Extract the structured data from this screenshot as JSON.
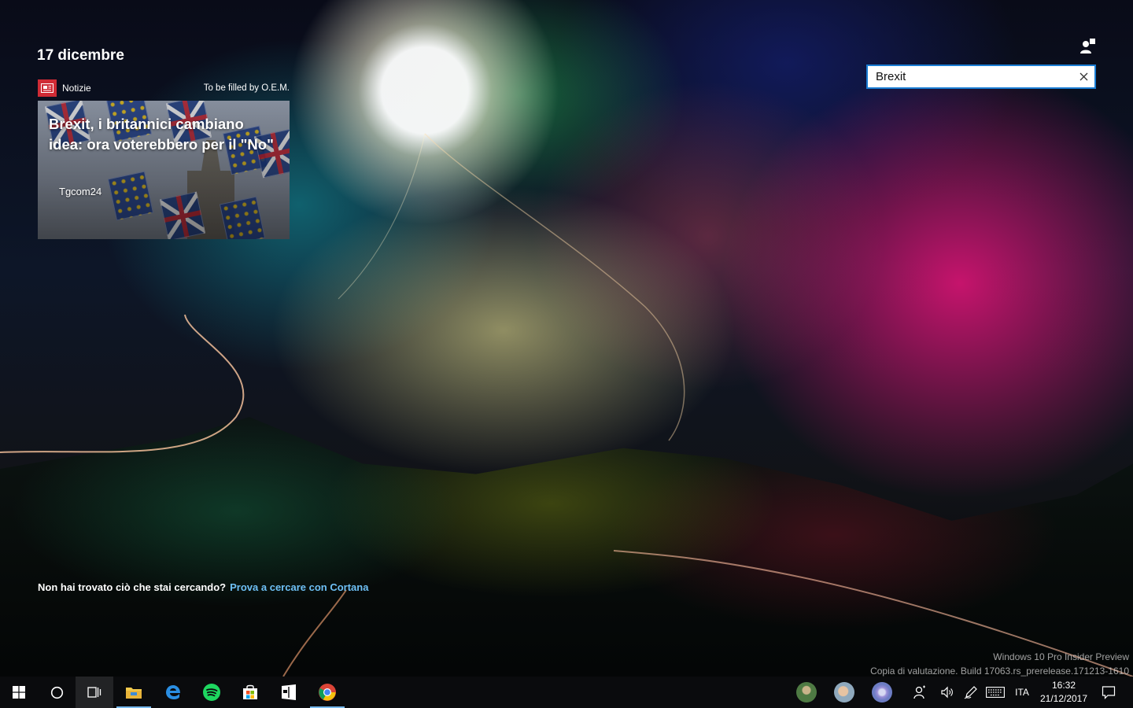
{
  "header": {
    "date": "17 dicembre"
  },
  "search": {
    "value": "Brexit",
    "placeholder": ""
  },
  "news": {
    "app_label": "Notizie",
    "attribution": "To be filled by O.E.M.",
    "headline": "Brexit, i britannici cambiano idea: ora voterebbero per il \"No\"",
    "source": "Tgcom24"
  },
  "cortana": {
    "question": "Non hai trovato ciò che stai cercando?",
    "link": "Prova a cercare con Cortana"
  },
  "watermark": {
    "line1": "Windows 10 Pro Insider Preview",
    "line2": "Copia di valutazione. Build 17063.rs_prerelease.171213-1610"
  },
  "taskbar": {
    "pinned": [
      "start-icon",
      "cortana-icon",
      "task-view-icon",
      "file-explorer-icon",
      "edge-icon",
      "spotify-icon",
      "store-icon",
      "news-app-icon",
      "chrome-icon"
    ],
    "tray": {
      "language": "ITA",
      "time": "16:32",
      "date": "21/12/2017"
    }
  },
  "colors": {
    "accent": "#1a7dd4",
    "link": "#6ec0f5",
    "news_red": "#cf2b35",
    "taskbar": "#0a0b0d"
  }
}
